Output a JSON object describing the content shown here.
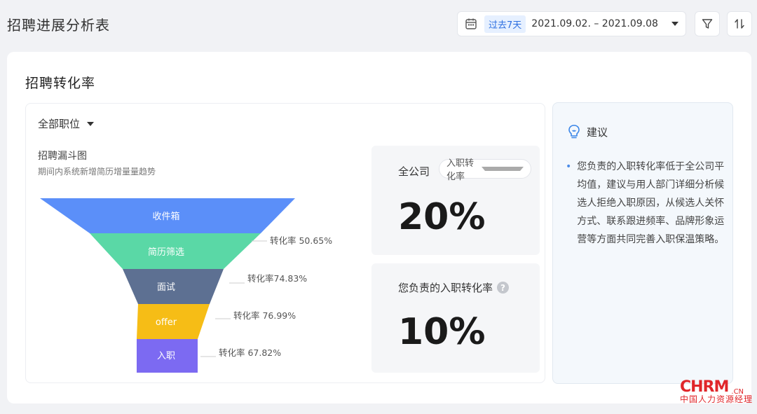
{
  "header": {
    "title": "招聘进展分析表",
    "date_range": {
      "preset": "过去7天",
      "range": "2021.09.02. – 2021.09.08"
    },
    "icons": [
      "calendar-icon",
      "filter-icon",
      "sort-icon"
    ]
  },
  "card": {
    "title": "招聘转化率",
    "position_filter": "全部职位",
    "funnel": {
      "title": "招聘漏斗图",
      "subtitle": "期间内系统新增简历增量量趋势",
      "stages": [
        {
          "label": "收件箱",
          "color": "#5b8ff9"
        },
        {
          "label": "简历筛选",
          "color": "#5ad8a6"
        },
        {
          "label": "面试",
          "color": "#5d7092"
        },
        {
          "label": "offer",
          "color": "#f6bd16"
        },
        {
          "label": "入职",
          "color": "#7c6af2"
        }
      ],
      "conversion_labels": [
        "转化率 50.65%",
        "转化率74.83%",
        "转化率 76.99%",
        "转化率 67.82%"
      ]
    },
    "company_stat": {
      "label": "全公司",
      "metric_select": "入职转化率",
      "value": "20%"
    },
    "my_stat": {
      "label": "您负责的入职转化率",
      "value": "10%"
    }
  },
  "suggestion": {
    "title": "建议",
    "text": "您负责的入职转化率低于全公司平均值，建议与用人部门详细分析候选人拒绝入职原因，从候选人关怀方式、联系跟进频率、品牌形象运营等方面共同完善入职保温策略。"
  },
  "watermark": {
    "main": "CHRM",
    "suffix": ".CN",
    "sub": "中国人力资源经理"
  }
}
